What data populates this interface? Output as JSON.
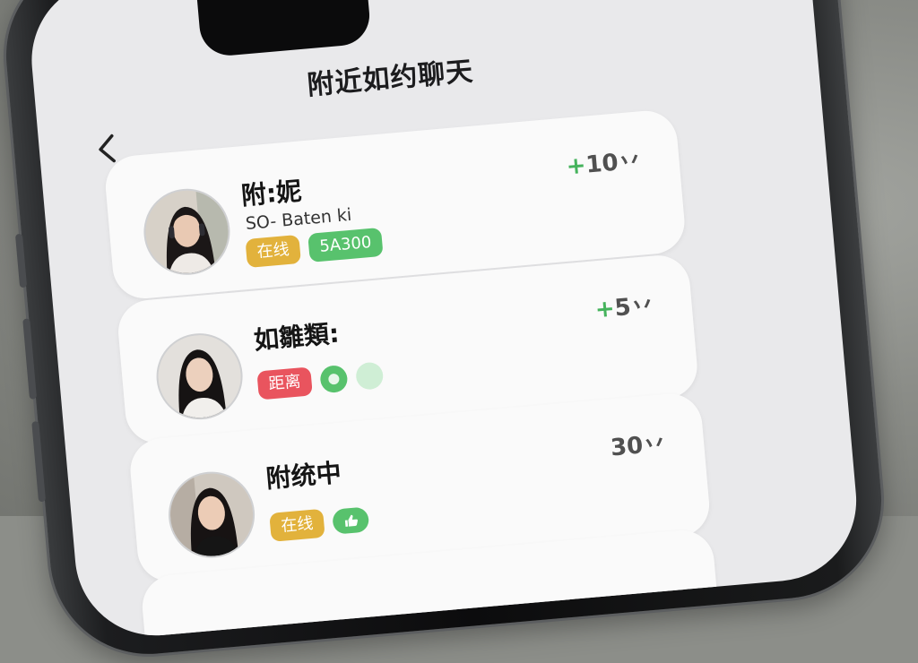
{
  "header": {
    "title": "附近如约聊天",
    "back_icon": "chevron-left-icon"
  },
  "colors": {
    "online": "#e2b23c",
    "green": "#58c26d",
    "red": "#e9545e",
    "plus": "#45b35c"
  },
  "users": [
    {
      "name": "附:妮",
      "subtitle": "SO- Baten ki",
      "tag_online": "在线",
      "tag_green": "5A300",
      "plus": "+",
      "points": "10丷"
    },
    {
      "name": "如雛類:",
      "tag_distance": "距离",
      "plus": "+",
      "points": "5丷"
    },
    {
      "name": "附统中",
      "tag_online": "在线",
      "points": "30丷"
    }
  ]
}
